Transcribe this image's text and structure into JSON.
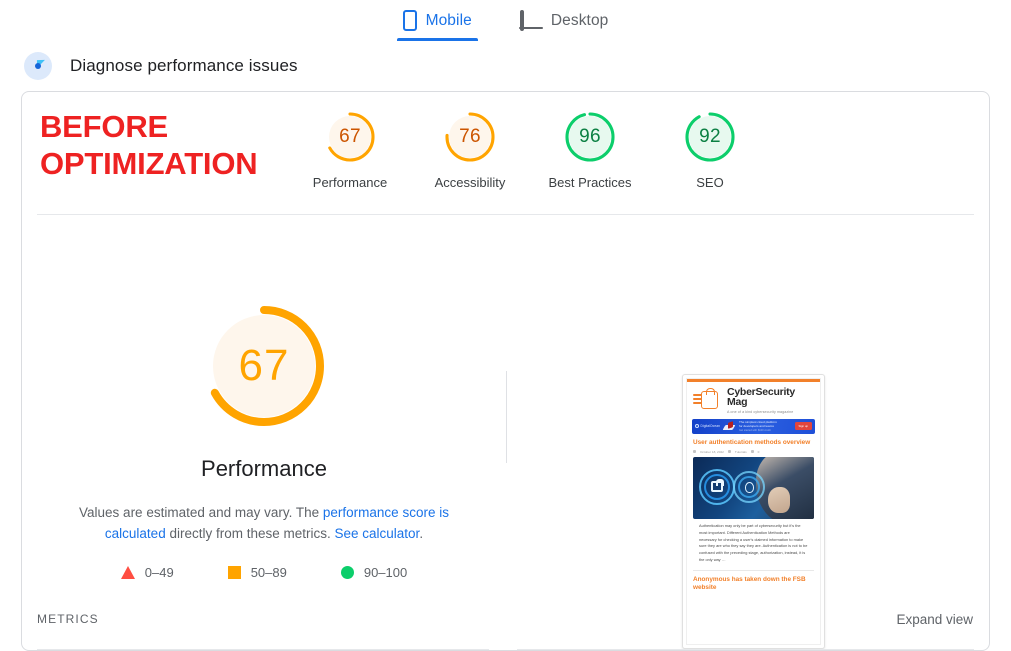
{
  "tabs": [
    {
      "label": "Mobile",
      "icon": "mobile-icon",
      "active": true
    },
    {
      "label": "Desktop",
      "icon": "desktop-icon",
      "active": false
    }
  ],
  "diagnose": {
    "icon": "speedometer-icon",
    "label": "Diagnose performance issues"
  },
  "report": {
    "banner_title_line1": "BEFORE",
    "banner_title_line2": "OPTIMIZATION",
    "banner_title_color": "#ee2222",
    "scores": [
      {
        "value": "67",
        "category": "Performance",
        "color": "#ffa400",
        "text_color": "#cc5500",
        "track": "#fef6ec",
        "percent": 67
      },
      {
        "value": "76",
        "category": "Accessibility",
        "color": "#ffa400",
        "text_color": "#cc5500",
        "track": "#fef6ec",
        "percent": 76
      },
      {
        "value": "96",
        "category": "Best Practices",
        "color": "#0cce6b",
        "text_color": "#0b8043",
        "track": "#e7f9ef",
        "percent": 96
      },
      {
        "value": "92",
        "category": "SEO",
        "color": "#0cce6b",
        "text_color": "#0b8043",
        "track": "#e7f9ef",
        "percent": 92
      }
    ]
  },
  "main_score": {
    "value": "67",
    "category": "Performance",
    "percent": 67,
    "color": "#ffa400",
    "track": "#fef6ec",
    "blurb_part1": "Values are estimated and may vary. The ",
    "blurb_link1": "performance score is calculated",
    "blurb_part2": " directly from these metrics. ",
    "blurb_link2": "See calculator",
    "blurb_part3": "."
  },
  "legend": [
    {
      "shape": "triangle-icon",
      "label": "0–49",
      "color": "#ff4e42"
    },
    {
      "shape": "square-icon",
      "label": "50–89",
      "color": "#ffa400"
    },
    {
      "shape": "circle-icon",
      "label": "90–100",
      "color": "#0cce6b"
    }
  ],
  "thumbnail": {
    "brand": "CyberSecurity Mag",
    "tagline": "A one of a kind cybersecurity magazine",
    "ad": {
      "brand": "DigitalOcean",
      "copy_line1": "The simplest cloud platform",
      "copy_line2": "for developers and teams",
      "fine_print": "Get started with $100 credit",
      "cta": "Sign up"
    },
    "article_title": "User authentication methods overview",
    "article_date": "October 18, 2022",
    "article_category": "Tutorials",
    "article_comments": "0",
    "article_body": "Authentication may only be part of cybersecurity but it's the most important. Different Authentication Methods are necessary for checking a user's claimed information to make sure they are who they say they are. Authentication is not to be confused with the preceding stage, authorization, instead, it is the only way …",
    "next_article_title": "Anonymous has taken down the FSB website"
  },
  "footer": {
    "metrics_label": "METRICS",
    "expand_label": "Expand view"
  }
}
